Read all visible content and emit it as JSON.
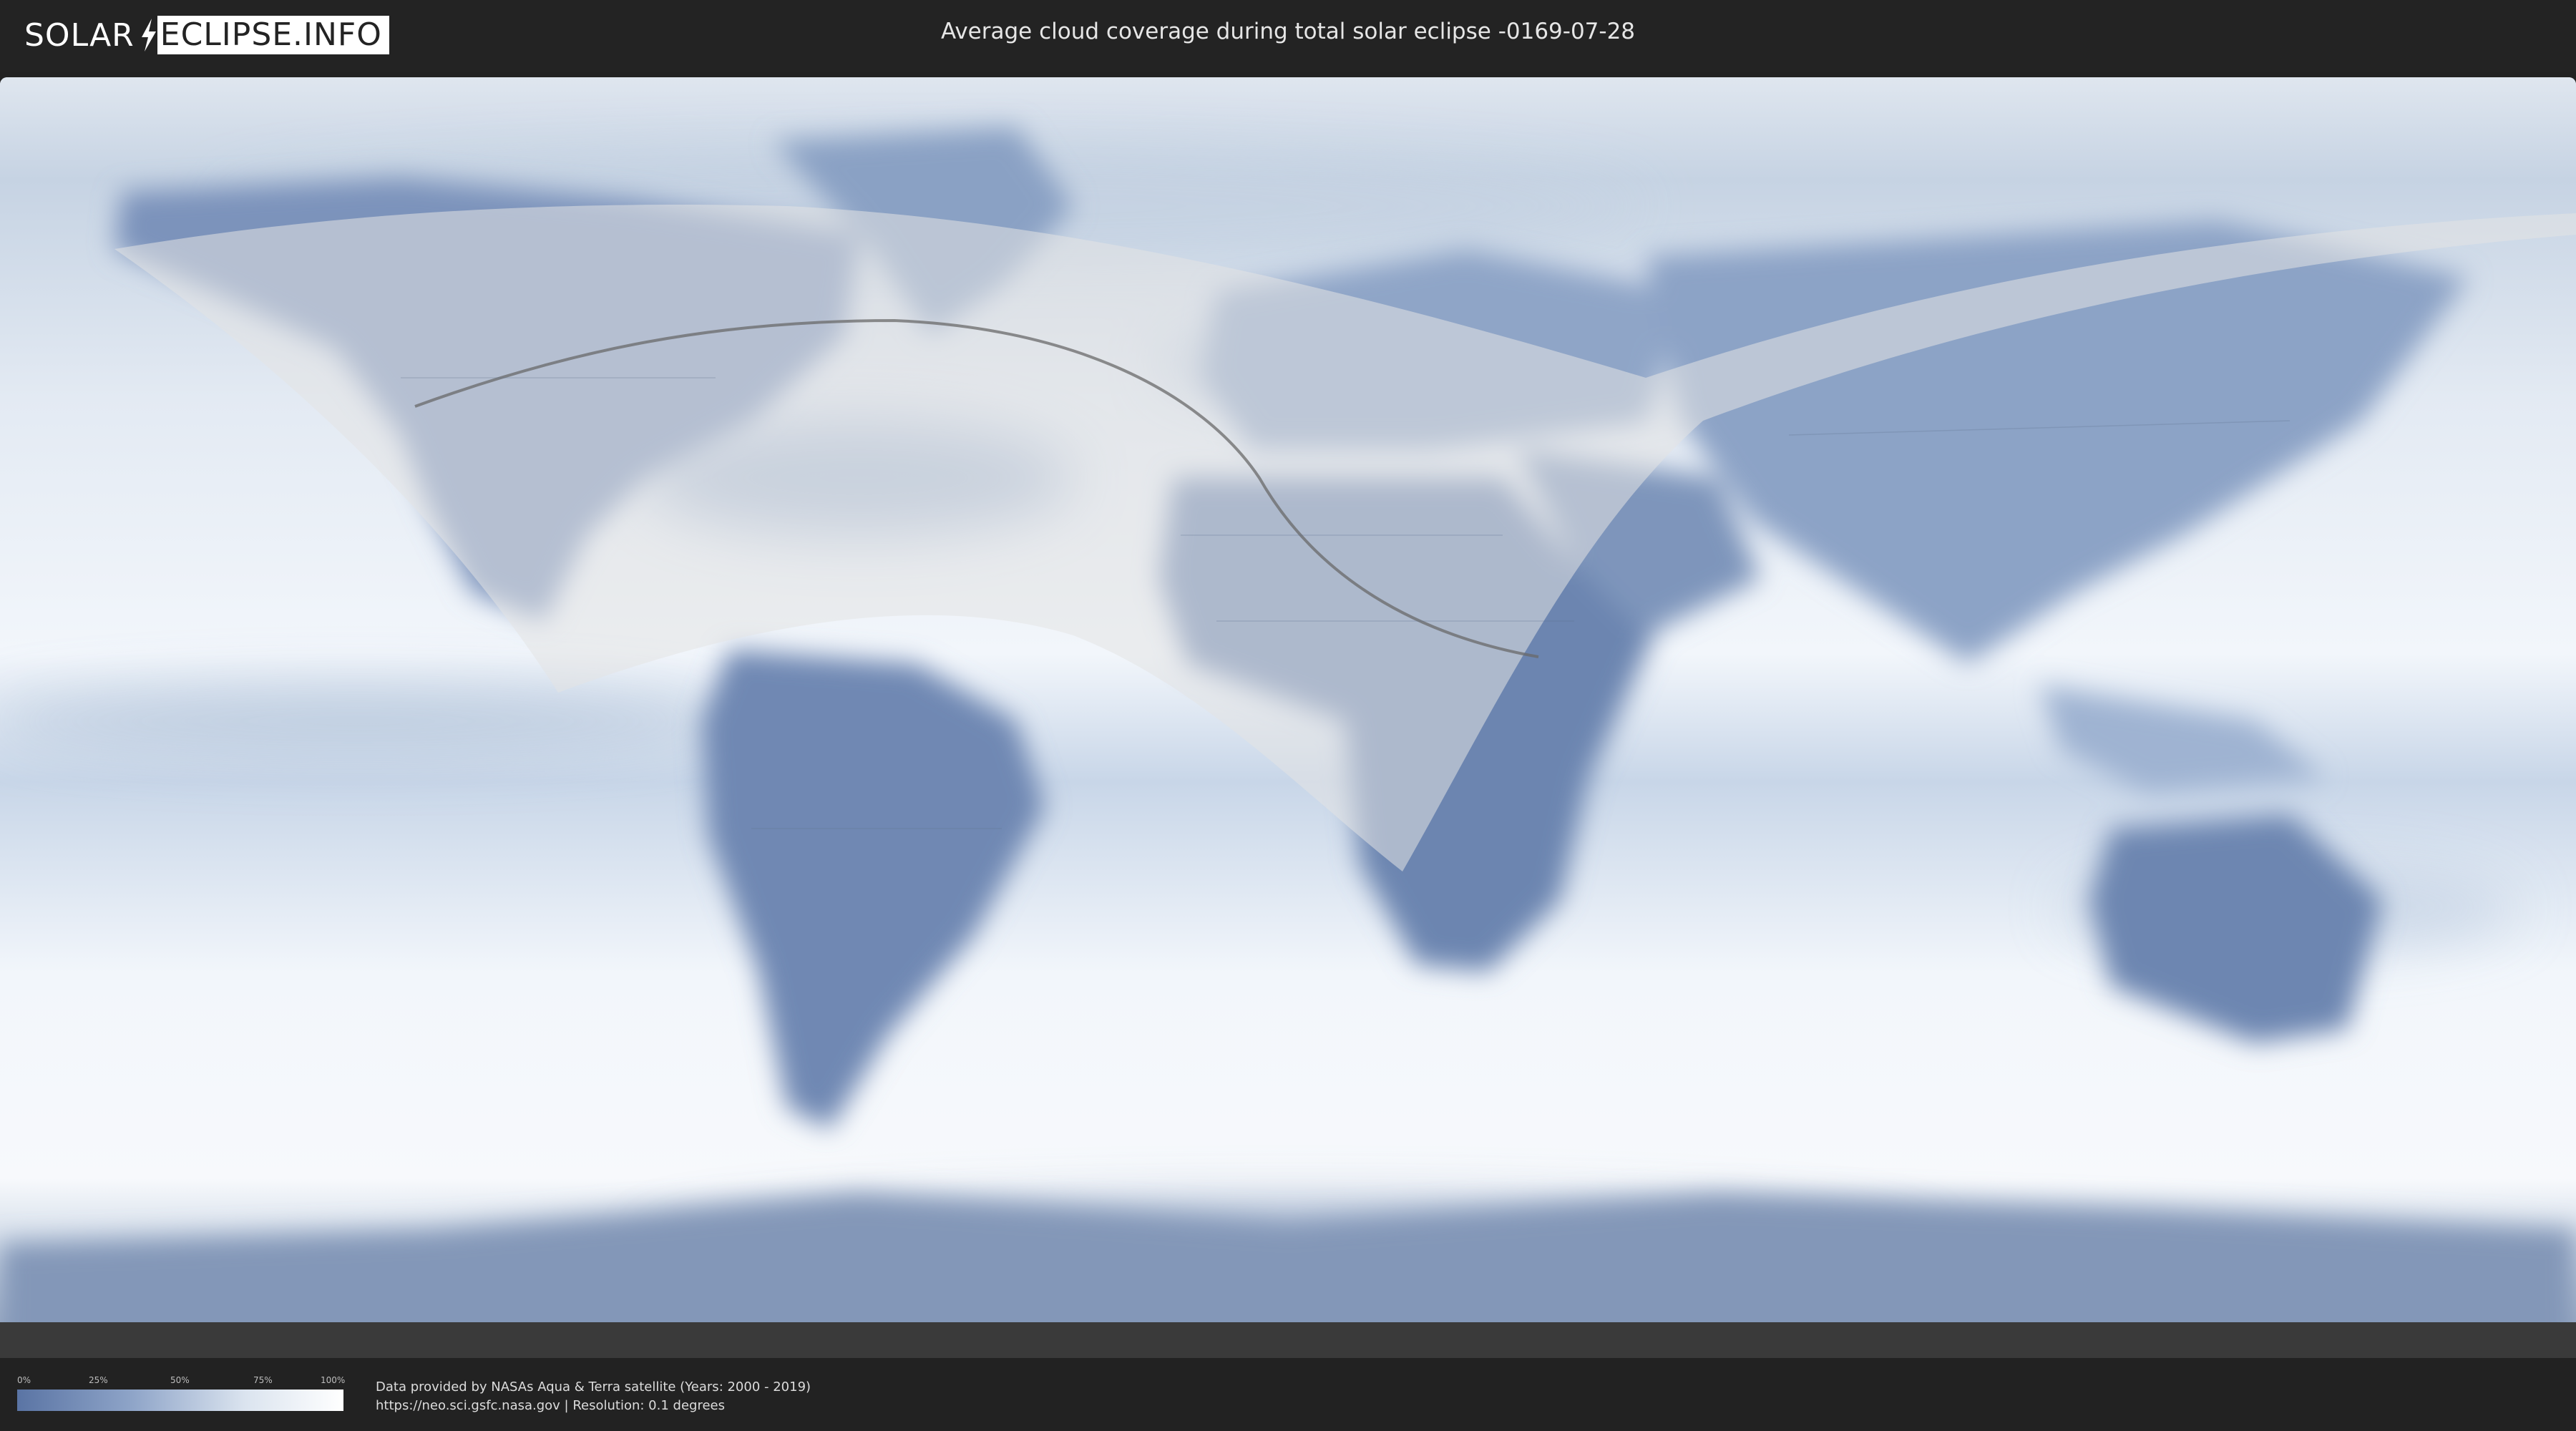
{
  "header": {
    "logo_part1": "SOLAR",
    "logo_part2": "ECLIPSE.INFO",
    "title": "Average cloud coverage during total solar eclipse -0169-07-28"
  },
  "legend": {
    "ticks": [
      "0%",
      "25%",
      "50%",
      "75%",
      "100%"
    ],
    "colors": {
      "low": "#5a74a4",
      "mid": "#8ea4c8",
      "high": "#ffffff"
    }
  },
  "credit": {
    "line1": "Data provided by NASAs Aqua & Terra satellite (Years: 2000 - 2019)",
    "line2": "https://neo.sci.gsfc.nasa.gov | Resolution: 0.1 degrees"
  },
  "colors": {
    "background": "#222222",
    "ocean_clear": "#f1f5fa",
    "land_cloudy": "#6f88b2",
    "eclipse_zone": "#e6e6e6",
    "path_line": "#6a6a6a"
  }
}
